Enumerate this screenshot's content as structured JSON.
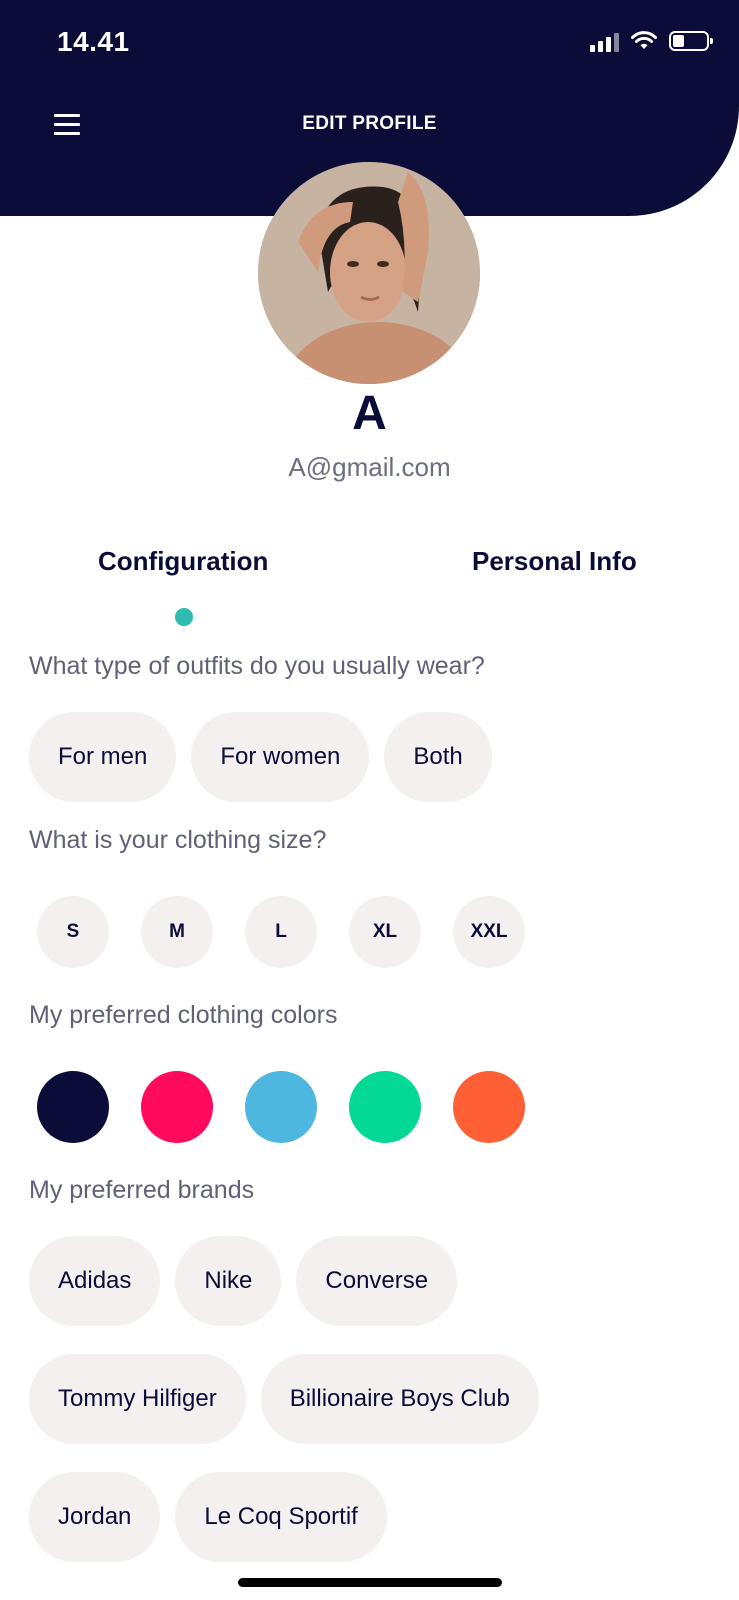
{
  "status_bar": {
    "time": "14.41"
  },
  "header": {
    "title": "EDIT PROFILE"
  },
  "profile": {
    "name": "A",
    "email": "A@gmail.com"
  },
  "tabs": [
    {
      "label": "Configuration",
      "active": true
    },
    {
      "label": "Personal Info",
      "active": false
    }
  ],
  "accent_color": "#2ebbad",
  "outfit": {
    "question": "What type of outfits do you usually wear?",
    "options": [
      "For men",
      "For women",
      "Both"
    ]
  },
  "size": {
    "question": "What is your clothing size?",
    "options": [
      "S",
      "M",
      "L",
      "XL",
      "XXL"
    ]
  },
  "colors": {
    "question": "My preferred clothing colors",
    "swatches": [
      "#0b0d38",
      "#ff0a5c",
      "#4db7df",
      "#03d895",
      "#ff5f34"
    ]
  },
  "brands": {
    "question": "My preferred brands",
    "rows": [
      [
        "Adidas",
        "Nike",
        "Converse"
      ],
      [
        "Tommy Hilfiger",
        "Billionaire Boys Club"
      ],
      [
        "Jordan",
        "Le Coq Sportif"
      ]
    ]
  }
}
